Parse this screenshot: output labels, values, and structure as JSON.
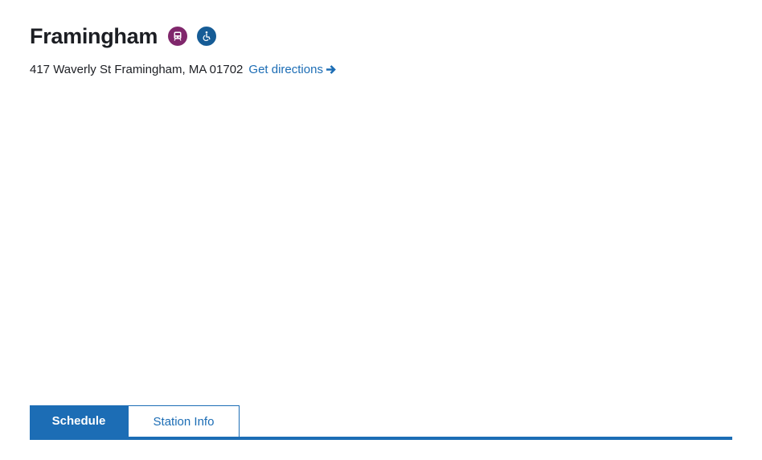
{
  "station": {
    "name": "Framingham",
    "address": "417 Waverly St Framingham, MA 01702",
    "directions_label": "Get directions"
  },
  "icons": {
    "commuter_rail": "commuter-rail-icon",
    "accessible": "wheelchair-accessible-icon",
    "directions_arrow": "arrow-right-icon"
  },
  "colors": {
    "commuter_rail": "#80276c",
    "accessible": "#165c96",
    "link": "#1c6db5",
    "text": "#1c1e23"
  },
  "tabs": [
    {
      "label": "Schedule",
      "active": true
    },
    {
      "label": "Station Info",
      "active": false
    }
  ]
}
